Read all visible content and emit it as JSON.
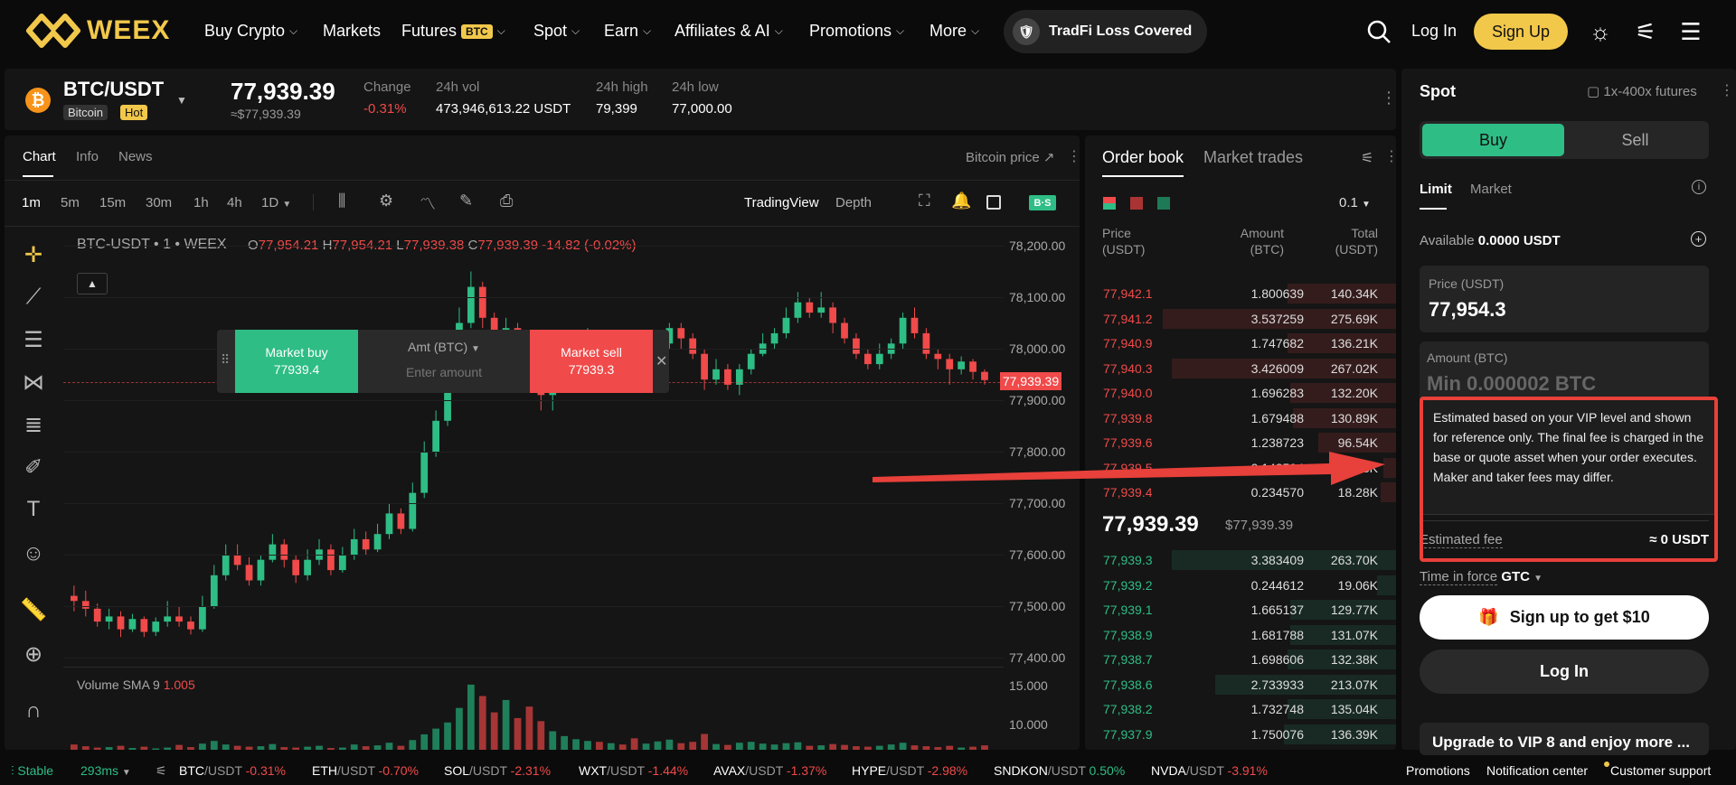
{
  "nav": {
    "logo": "WEEX",
    "items": [
      {
        "label": "Buy Crypto",
        "chevron": true
      },
      {
        "label": "Markets",
        "chevron": false
      },
      {
        "label": "Futures",
        "badge": "BTC",
        "chevron": true
      },
      {
        "label": "Spot",
        "chevron": true
      },
      {
        "label": "Earn",
        "chevron": true
      },
      {
        "label": "Affiliates & AI",
        "chevron": true
      },
      {
        "label": "Promotions",
        "chevron": true
      },
      {
        "label": "More",
        "chevron": true
      }
    ],
    "tradfi": "TradFi Loss Covered",
    "login": "Log In",
    "signup": "Sign Up"
  },
  "ticker": {
    "pair": "BTC/USDT",
    "name": "Bitcoin",
    "hot": "Hot",
    "price": "77,939.39",
    "price_usd": "≈$77,939.39",
    "change_label": "Change",
    "change": "-0.31%",
    "vol_label": "24h vol",
    "vol": "473,946,613.22 USDT",
    "high_label": "24h high",
    "high": "79,399",
    "low_label": "24h low",
    "low": "77,000.00"
  },
  "chart": {
    "tabs": [
      "Chart",
      "Info",
      "News"
    ],
    "bitcoin_price": "Bitcoin price ↗",
    "timeframes": [
      "1m",
      "5m",
      "15m",
      "30m",
      "1h",
      "4h",
      "1D"
    ],
    "views": [
      "TradingView",
      "Depth"
    ],
    "legend_title": "BTC-USDT • 1 • WEEX",
    "ohlc": {
      "o": "77,954.21",
      "h": "77,954.21",
      "l": "77,939.38",
      "c": "77,939.39",
      "chg": "-14.82 (-0.02%)"
    },
    "price_tag": "77,939.39",
    "volume_label": "Volume SMA 9",
    "volume_value": "1.005",
    "quick_trade": {
      "buy_label": "Market buy",
      "buy_price": "77939.4",
      "amt_label": "Amt (BTC)",
      "amt_placeholder": "Enter amount",
      "sell_label": "Market sell",
      "sell_price": "77939.3"
    }
  },
  "chart_data": {
    "type": "candlestick",
    "y_ticks": [
      "78,200.00",
      "78,100.00",
      "78,000.00",
      "77,900.00",
      "77,800.00",
      "77,700.00",
      "77,600.00",
      "77,500.00",
      "77,400.00"
    ],
    "volume_ticks": [
      "15.000",
      "10.000"
    ],
    "ylim": [
      77380,
      78240
    ],
    "candles": [
      [
        77520,
        77510,
        77540,
        77490
      ],
      [
        77510,
        77495,
        77530,
        77480
      ],
      [
        77495,
        77470,
        77505,
        77460
      ],
      [
        77470,
        77480,
        77495,
        77455
      ],
      [
        77480,
        77455,
        77490,
        77440
      ],
      [
        77455,
        77475,
        77485,
        77450
      ],
      [
        77475,
        77450,
        77480,
        77440
      ],
      [
        77450,
        77470,
        77478,
        77442
      ],
      [
        77470,
        77480,
        77510,
        77460
      ],
      [
        77480,
        77470,
        77500,
        77460
      ],
      [
        77470,
        77455,
        77480,
        77445
      ],
      [
        77455,
        77500,
        77520,
        77450
      ],
      [
        77500,
        77560,
        77580,
        77495
      ],
      [
        77560,
        77600,
        77620,
        77550
      ],
      [
        77600,
        77580,
        77620,
        77570
      ],
      [
        77580,
        77550,
        77595,
        77540
      ],
      [
        77550,
        77590,
        77600,
        77540
      ],
      [
        77590,
        77620,
        77640,
        77585
      ],
      [
        77620,
        77590,
        77630,
        77575
      ],
      [
        77590,
        77560,
        77600,
        77545
      ],
      [
        77560,
        77590,
        77610,
        77550
      ],
      [
        77590,
        77610,
        77630,
        77580
      ],
      [
        77610,
        77570,
        77620,
        77560
      ],
      [
        77570,
        77600,
        77615,
        77565
      ],
      [
        77600,
        77630,
        77650,
        77590
      ],
      [
        77630,
        77610,
        77645,
        77600
      ],
      [
        77610,
        77640,
        77660,
        77605
      ],
      [
        77640,
        77680,
        77700,
        77630
      ],
      [
        77680,
        77650,
        77690,
        77640
      ],
      [
        77650,
        77720,
        77740,
        77645
      ],
      [
        77720,
        77800,
        77820,
        77710
      ],
      [
        77800,
        77860,
        77880,
        77790
      ],
      [
        77860,
        77950,
        77980,
        77850
      ],
      [
        77950,
        78050,
        78080,
        77940
      ],
      [
        78050,
        78120,
        78150,
        78040
      ],
      [
        78120,
        78060,
        78130,
        78040
      ],
      [
        78060,
        78000,
        78070,
        77980
      ],
      [
        78000,
        78040,
        78060,
        77990
      ],
      [
        78040,
        78020,
        78050,
        78000
      ],
      [
        78020,
        77960,
        78030,
        77950
      ],
      [
        77960,
        77910,
        77970,
        77880
      ],
      [
        77910,
        77930,
        77950,
        77880
      ],
      [
        77930,
        77960,
        77980,
        77920
      ],
      [
        77960,
        77990,
        78010,
        77950
      ],
      [
        77990,
        78020,
        78040,
        77980
      ],
      [
        78020,
        78000,
        78035,
        77990
      ],
      [
        78000,
        78010,
        78030,
        77990
      ],
      [
        78010,
        77990,
        78025,
        77980
      ],
      [
        77990,
        77950,
        78000,
        77930
      ],
      [
        77950,
        77980,
        78000,
        77940
      ],
      [
        77980,
        78010,
        78030,
        77970
      ],
      [
        78010,
        78040,
        78050,
        78000
      ],
      [
        78040,
        78020,
        78050,
        78000
      ],
      [
        78020,
        77990,
        78030,
        77980
      ],
      [
        77990,
        77940,
        78000,
        77920
      ],
      [
        77940,
        77960,
        77980,
        77930
      ],
      [
        77960,
        77930,
        77970,
        77920
      ],
      [
        77930,
        77960,
        77970,
        77910
      ],
      [
        77960,
        77990,
        78000,
        77950
      ],
      [
        77990,
        78010,
        78030,
        77985
      ],
      [
        78010,
        78030,
        78040,
        78000
      ],
      [
        78030,
        78060,
        78080,
        78020
      ],
      [
        78060,
        78090,
        78110,
        78050
      ],
      [
        78090,
        78070,
        78100,
        78060
      ],
      [
        78070,
        78080,
        78110,
        78060
      ],
      [
        78080,
        78050,
        78090,
        78030
      ],
      [
        78050,
        78020,
        78060,
        78010
      ],
      [
        78020,
        77990,
        78030,
        77980
      ],
      [
        77990,
        77970,
        78000,
        77960
      ],
      [
        77970,
        77990,
        78010,
        77960
      ],
      [
        77990,
        78010,
        78020,
        77980
      ],
      [
        78010,
        78060,
        78070,
        78000
      ],
      [
        78060,
        78030,
        78080,
        78020
      ],
      [
        78030,
        77990,
        78040,
        77980
      ],
      [
        77990,
        77980,
        78000,
        77960
      ],
      [
        77980,
        77960,
        77990,
        77930
      ],
      [
        77960,
        77975,
        77985,
        77950
      ],
      [
        77975,
        77955,
        77980,
        77940
      ],
      [
        77955,
        77939,
        77960,
        77930
      ]
    ],
    "volumes": [
      1.2,
      0.8,
      0.5,
      0.6,
      0.9,
      0.4,
      0.7,
      0.3,
      0.5,
      1.1,
      0.6,
      1.4,
      2.0,
      1.2,
      0.9,
      0.7,
      0.8,
      1.3,
      0.6,
      0.5,
      0.7,
      0.9,
      0.4,
      0.5,
      1.2,
      0.8,
      1.0,
      1.6,
      0.9,
      2.2,
      3.5,
      4.8,
      6.2,
      9.5,
      14.8,
      12.2,
      8.5,
      11.3,
      7.2,
      9.8,
      6.5,
      4.2,
      3.1,
      2.4,
      2.0,
      1.8,
      1.5,
      1.2,
      2.6,
      1.4,
      1.9,
      2.3,
      1.5,
      1.8,
      3.6,
      1.3,
      1.1,
      1.6,
      1.8,
      1.4,
      1.2,
      1.5,
      1.7,
      0.9,
      1.0,
      1.3,
      1.1,
      0.8,
      0.7,
      0.9,
      1.2,
      1.6,
      1.0,
      0.8,
      0.6,
      0.9,
      0.5,
      0.7,
      1.005
    ]
  },
  "orderbook": {
    "tabs": [
      "Order book",
      "Market trades"
    ],
    "step": "0.1",
    "headers": {
      "price": "Price\n(USDT)",
      "amount": "Amount\n(BTC)",
      "total": "Total\n(USDT)"
    },
    "asks": [
      {
        "p": "77,942.1",
        "a": "1.800639",
        "t": "140.34K",
        "w": 0.35
      },
      {
        "p": "77,941.2",
        "a": "3.537259",
        "t": "275.69K",
        "w": 0.75
      },
      {
        "p": "77,940.9",
        "a": "1.747682",
        "t": "136.21K",
        "w": 0.35
      },
      {
        "p": "77,940.3",
        "a": "3.426009",
        "t": "267.02K",
        "w": 0.72
      },
      {
        "p": "77,940.0",
        "a": "1.696283",
        "t": "132.20K",
        "w": 0.34
      },
      {
        "p": "77,939.8",
        "a": "1.679488",
        "t": "130.89K",
        "w": 0.33
      },
      {
        "p": "77,939.6",
        "a": "1.238723",
        "t": "96.54K",
        "w": 0.25
      },
      {
        "p": "77,939.5",
        "a": "0.148594",
        "t": "11.58K",
        "w": 0.04
      },
      {
        "p": "77,939.4",
        "a": "0.234570",
        "t": "18.28K",
        "w": 0.05
      }
    ],
    "mid_price": "77,939.39",
    "mid_usd": "$77,939.39",
    "bids": [
      {
        "p": "77,939.3",
        "a": "3.383409",
        "t": "263.70K",
        "w": 0.72
      },
      {
        "p": "77,939.2",
        "a": "0.244612",
        "t": "19.06K",
        "w": 0.06
      },
      {
        "p": "77,939.1",
        "a": "1.665137",
        "t": "129.77K",
        "w": 0.34
      },
      {
        "p": "77,938.9",
        "a": "1.681788",
        "t": "131.07K",
        "w": 0.34
      },
      {
        "p": "77,938.7",
        "a": "1.698606",
        "t": "132.38K",
        "w": 0.35
      },
      {
        "p": "77,938.6",
        "a": "2.733933",
        "t": "213.07K",
        "w": 0.58
      },
      {
        "p": "77,938.2",
        "a": "1.732748",
        "t": "135.04K",
        "w": 0.35
      },
      {
        "p": "77,937.9",
        "a": "1.750076",
        "t": "136.39K",
        "w": 0.36
      }
    ]
  },
  "spot": {
    "title": "Spot",
    "futures_link": "1x-400x futures",
    "buy": "Buy",
    "sell": "Sell",
    "order_tabs": [
      "Limit",
      "Market"
    ],
    "available_label": "Available",
    "available_value": "0.0000 USDT",
    "price_label": "Price (USDT)",
    "price_value": "77,954.3",
    "amount_label": "Amount (BTC)",
    "amount_placeholder": "Min 0.000002 BTC",
    "tooltip": "Estimated based on your VIP level and shown for reference only. The final fee is charged in the base or quote asset when your order executes. Maker and taker fees may differ.",
    "fee_label": "Estimated fee",
    "fee_value": "≈ 0 USDT",
    "tif_label": "Time in force",
    "tif_value": "GTC",
    "signup_cta": "Sign up to get $10",
    "login_cta": "Log In",
    "vip_banner": "Upgrade to VIP 8 and enjoy more ..."
  },
  "bottom": {
    "status": "Stable",
    "latency": "293ms",
    "pairs": [
      {
        "base": "BTC",
        "quote": "/USDT",
        "chg": "-0.31%",
        "up": false
      },
      {
        "base": "ETH",
        "quote": "/USDT",
        "chg": "-0.70%",
        "up": false
      },
      {
        "base": "SOL",
        "quote": "/USDT",
        "chg": "-2.31%",
        "up": false
      },
      {
        "base": "WXT",
        "quote": "/USDT",
        "chg": "-1.44%",
        "up": false
      },
      {
        "base": "AVAX",
        "quote": "/USDT",
        "chg": "-1.37%",
        "up": false
      },
      {
        "base": "HYPE",
        "quote": "/USDT",
        "chg": "-2.98%",
        "up": false
      },
      {
        "base": "SNDKON",
        "quote": "/USDT",
        "chg": "0.50%",
        "up": true
      },
      {
        "base": "NVDA",
        "quote": "/USDT",
        "chg": "-3.91%",
        "up": false
      }
    ],
    "links": [
      "Promotions",
      "Notification center",
      "Customer support"
    ]
  },
  "colors": {
    "accent": "#f2c84b",
    "up": "#2ebd85",
    "down": "#f04a4a",
    "annotation": "#e8403a"
  }
}
